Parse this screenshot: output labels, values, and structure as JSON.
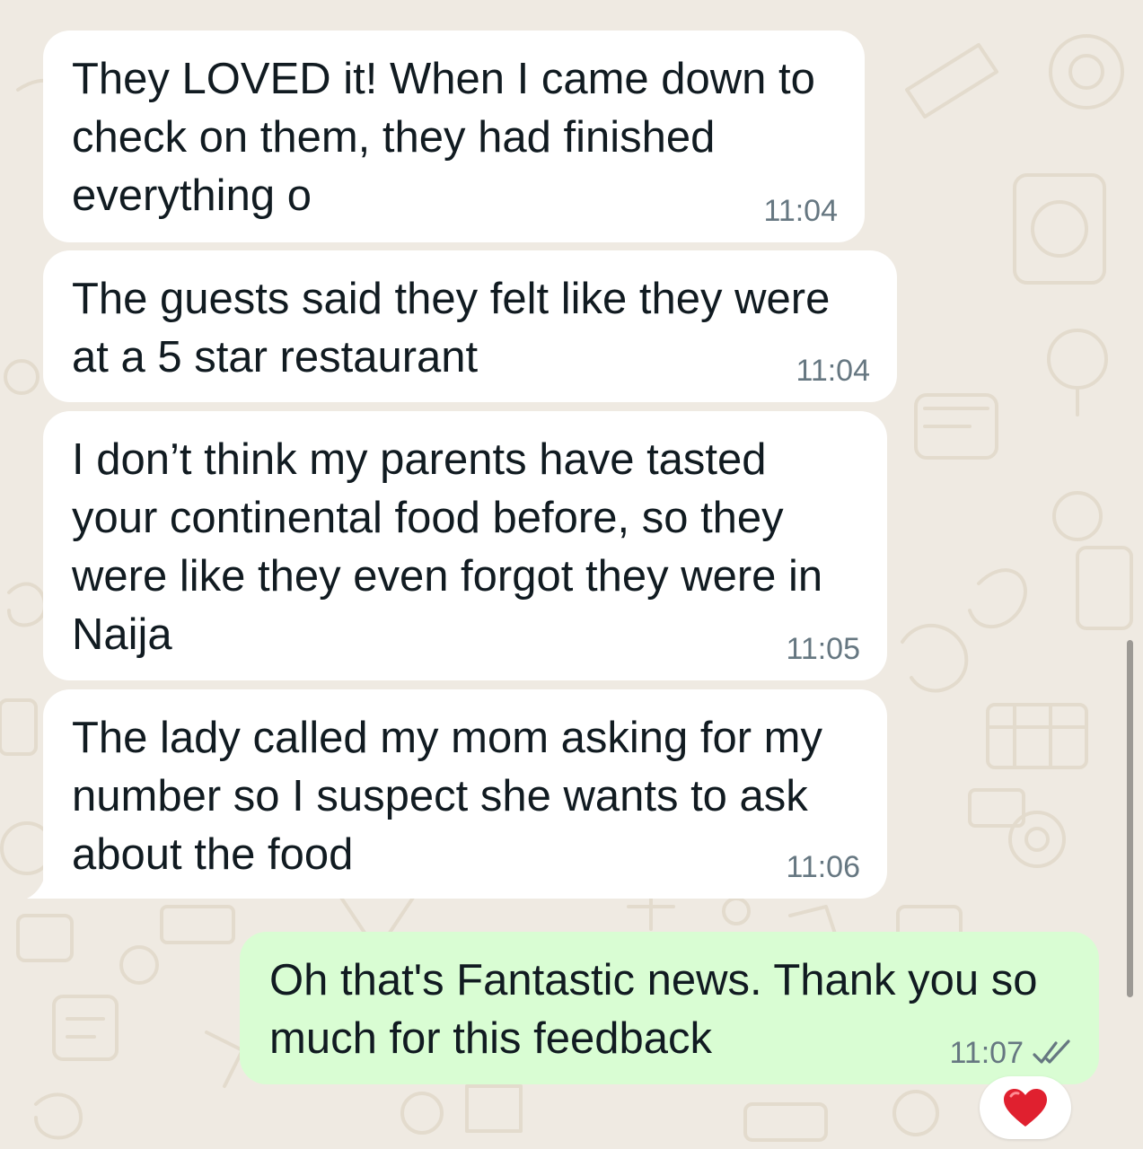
{
  "chat": {
    "messages": [
      {
        "direction": "incoming",
        "text": "They LOVED it! When I came down to check on them, they had finished everything o",
        "time": "11:04"
      },
      {
        "direction": "incoming",
        "text": "The guests said they felt like they were at a 5 star restaurant",
        "time": "11:04"
      },
      {
        "direction": "incoming",
        "text": "I don’t think my parents have tasted your continental food before, so they were like they even forgot they were in Naija",
        "time": "11:05"
      },
      {
        "direction": "incoming",
        "text": "The lady called my mom asking for my number so I suspect she wants to ask about the food",
        "time": "11:06"
      },
      {
        "direction": "outgoing",
        "text": "Oh that's Fantastic news. Thank you so much for this feedback",
        "time": "11:07",
        "status_icon": "double-check-read-icon"
      }
    ],
    "reaction": {
      "emoji": "❤️",
      "icon": "red-heart-icon"
    }
  },
  "colors": {
    "background": "#efeae2",
    "incoming_bubble": "#ffffff",
    "outgoing_bubble": "#d9fdd3",
    "text": "#111b21",
    "timestamp": "#667781",
    "heart": "#e0202f"
  }
}
